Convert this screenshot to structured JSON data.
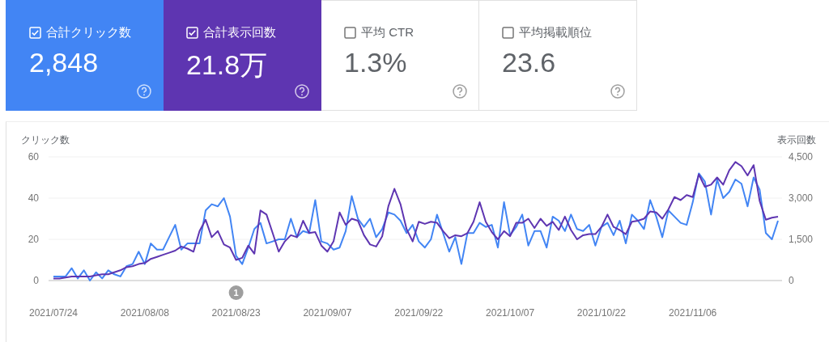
{
  "metric_cards": [
    {
      "label": "合計クリック数",
      "value": "2,848",
      "checked": true,
      "color": "#4285f4"
    },
    {
      "label": "合計表示回数",
      "value": "21.8万",
      "checked": true,
      "color": "#5e35b1"
    },
    {
      "label": "平均 CTR",
      "value": "1.3%",
      "checked": false
    },
    {
      "label": "平均掲載順位",
      "value": "23.6",
      "checked": false
    }
  ],
  "chart": {
    "chart_data": {
      "type": "line",
      "ylabel": "クリック数",
      "y2label": "表示回数",
      "ylim": [
        0,
        60
      ],
      "y2lim": [
        0,
        4500
      ],
      "annotations": [
        "1"
      ],
      "categories": [
        "2021/07/24",
        null,
        null,
        null,
        null,
        null,
        null,
        null,
        null,
        null,
        null,
        null,
        null,
        null,
        null,
        "2021/08/08",
        null,
        null,
        null,
        null,
        null,
        null,
        null,
        null,
        null,
        null,
        null,
        null,
        null,
        null,
        "2021/08/23",
        null,
        null,
        null,
        null,
        null,
        null,
        null,
        null,
        null,
        null,
        null,
        null,
        null,
        null,
        "2021/09/07",
        null,
        null,
        null,
        null,
        null,
        null,
        null,
        null,
        null,
        null,
        null,
        null,
        null,
        null,
        "2021/09/22",
        null,
        null,
        null,
        null,
        null,
        null,
        null,
        null,
        null,
        null,
        null,
        null,
        null,
        null,
        "2021/10/07",
        null,
        null,
        null,
        null,
        null,
        null,
        null,
        null,
        null,
        null,
        null,
        null,
        null,
        null,
        "2021/10/22",
        null,
        null,
        null,
        null,
        null,
        null,
        null,
        null,
        null,
        null,
        null,
        null,
        null,
        null,
        "2021/11/06",
        null,
        null,
        null,
        null,
        null,
        null,
        null,
        null,
        null,
        null,
        null,
        null,
        null,
        null
      ],
      "yticks": [
        0,
        20,
        40,
        60
      ],
      "y2ticks": [
        {
          "value": 0,
          "label": "0"
        },
        {
          "value": 1500,
          "label": "1,500"
        },
        {
          "value": 3000,
          "label": "3,000"
        },
        {
          "value": 4500,
          "label": "4,500"
        }
      ],
      "series": [
        {
          "color": "#4285f4",
          "values": [
            2,
            2,
            2,
            6,
            1,
            5,
            0,
            4,
            1,
            5,
            3,
            2,
            7,
            8,
            14,
            8,
            18,
            15,
            15,
            21,
            27,
            15,
            18,
            18,
            18,
            34,
            37,
            36,
            40,
            31,
            12,
            8,
            16,
            25,
            28,
            18,
            19,
            20,
            20,
            30,
            21,
            24,
            23,
            39,
            19,
            18,
            15,
            16,
            24,
            41,
            30,
            26,
            30,
            21,
            25,
            33,
            32,
            29,
            23,
            27,
            19,
            16,
            20,
            32,
            23,
            14,
            21,
            8,
            23,
            23,
            28,
            26,
            27,
            16,
            38,
            22,
            26,
            32,
            17,
            24,
            24,
            16,
            31,
            29,
            24,
            32,
            25,
            24,
            27,
            17,
            26,
            28,
            22,
            29,
            18,
            32,
            29,
            25,
            39,
            31,
            21,
            34,
            31,
            28,
            27,
            38,
            52,
            48,
            32,
            49,
            40,
            43,
            49,
            47,
            36,
            50,
            44,
            23,
            20,
            29
          ]
        },
        {
          "axis": "y2",
          "color": "#5e35b1",
          "values": [
            75,
            75,
            113,
            150,
            150,
            150,
            150,
            188,
            225,
            225,
            300,
            375,
            488,
            525,
            600,
            638,
            788,
            863,
            938,
            1013,
            1088,
            1238,
            1163,
            1050,
            1800,
            2213,
            1575,
            1800,
            1313,
            1200,
            750,
            825,
            1275,
            975,
            2550,
            2400,
            1725,
            1050,
            1425,
            1650,
            1575,
            2175,
            1725,
            1763,
            1275,
            1050,
            1425,
            2475,
            2025,
            2250,
            2175,
            1650,
            1313,
            1238,
            1613,
            2700,
            3338,
            2775,
            1875,
            1425,
            2138,
            2063,
            2138,
            2100,
            1800,
            1538,
            1650,
            1613,
            1725,
            2138,
            2850,
            2138,
            1763,
            1500,
            1800,
            1613,
            2100,
            2100,
            2250,
            1913,
            2250,
            1988,
            2138,
            1838,
            2325,
            1838,
            1500,
            1650,
            1688,
            1688,
            1950,
            2400,
            1950,
            1838,
            1688,
            2138,
            2175,
            2250,
            2513,
            2475,
            2250,
            2588,
            3038,
            2925,
            3113,
            3038,
            3863,
            3413,
            3488,
            3750,
            3488,
            4013,
            4313,
            4163,
            3825,
            4200,
            2888,
            2213,
            2288,
            2325
          ]
        }
      ]
    }
  }
}
